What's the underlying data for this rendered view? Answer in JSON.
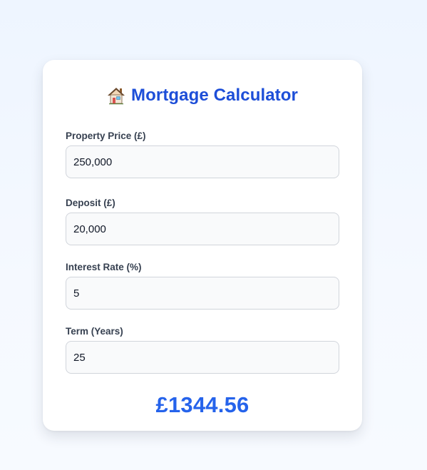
{
  "calculator": {
    "title": "Mortgage Calculator",
    "icon": "house-icon",
    "fields": [
      {
        "label": "Property Price (£)",
        "value": "250,000"
      },
      {
        "label": "Deposit (£)",
        "value": "20,000"
      },
      {
        "label": "Interest Rate (%)",
        "value": "5"
      },
      {
        "label": "Term (Years)",
        "value": "25"
      }
    ],
    "result": "£1344.56"
  },
  "colors": {
    "accent": "#1d4ed8",
    "result": "#2563eb",
    "label": "#374151",
    "input_border": "#d1d5db",
    "input_bg": "#f9fafb"
  }
}
